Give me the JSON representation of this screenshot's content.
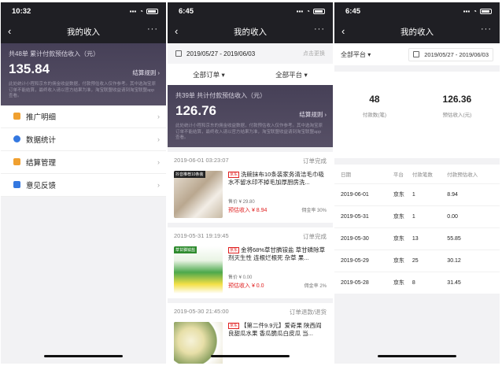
{
  "screens": [
    {
      "time": "10:32",
      "title": "我的收入",
      "more": "···",
      "summary": {
        "count_text": "共48单 累计付款预估收入（元）",
        "amount": "135.84",
        "rule": "结算规则 ›",
        "note": "此处统计小程和京东的佣金收益数据，付款预估收入仅作参考。其中选淘宝原订单不能结算，最终收入请以官方结果为准，淘宝联盟收益请到淘宝联盟app查看。"
      },
      "menu": [
        {
          "label": "推广明细",
          "icon": "list-icon",
          "color": "#f0a030"
        },
        {
          "label": "数据统计",
          "icon": "chart-icon",
          "color": "#3478e0"
        },
        {
          "label": "结算管理",
          "icon": "settlement-icon",
          "color": "#f0a030"
        },
        {
          "label": "意见反馈",
          "icon": "feedback-icon",
          "color": "#3478e0"
        }
      ]
    },
    {
      "time": "6:45",
      "title": "我的收入",
      "more": "···",
      "date_range": "2019/05/27 - 2019/06/03",
      "date_change": "点击更换",
      "filters": [
        "全部订单 ▾",
        "全部平台 ▾"
      ],
      "summary": {
        "count_text": "共39单 共计付款预估收入（元）",
        "amount": "126.76",
        "rule": "结算规则 ›",
        "note": "此处统计小程和京东的佣金收益数据，付款预估收入仅作参考。其中选淘宝原订单不能结算，最终收入请以官方结果为准，淘宝联盟收益请到淘宝联盟app查看。"
      },
      "orders": [
        {
          "time": "2019-06-01 03:23:07",
          "status": "订单完成",
          "platform": "京东",
          "title": "洗碗抹布10条装家务清洁毛巾吸水不留水印不掉毛加厚厨房洗...",
          "thumb_tag": "抖音推荐10条装",
          "price": "售价 ¥ 29.80",
          "estimate": "预估收入 ¥ 8.94",
          "rate": "佣金率 30%"
        },
        {
          "time": "2019-05-31 19:19:45",
          "status": "订单完成",
          "platform": "京东",
          "title": "金将68%草甘膦铵盐 草甘磷除草剂灭生性 连根烂根死 杂草 果...",
          "thumb_tag": "草甘膦铵盐",
          "price": "售价 ¥ 0.00",
          "estimate": "预估收入 ¥ 0.0",
          "rate": "佣金率 2%"
        },
        {
          "time": "2019-05-30 21:45:00",
          "status": "订单退款/退货",
          "platform": "京东",
          "title": "【第二件9.9元】爱奇果 陕西阎良甜瓜水果 香瓜脆瓜白皮瓜 当...",
          "thumb_tag": "",
          "price": "",
          "estimate": "",
          "rate": ""
        }
      ]
    },
    {
      "time": "6:45",
      "title": "我的收入",
      "more": "···",
      "platform_filter": "全部平台 ▾",
      "date_range": "2019/05/27 - 2019/06/03",
      "stats": [
        {
          "value": "48",
          "label": "付款数(笔)"
        },
        {
          "value": "126.36",
          "label": "预估收入(元)"
        }
      ],
      "table_headers": [
        "日期",
        "平台",
        "付款笔数",
        "付款预估收入"
      ],
      "rows": [
        [
          "2019-06-01",
          "京东",
          "1",
          "8.94"
        ],
        [
          "2019-05-31",
          "京东",
          "1",
          "0.00"
        ],
        [
          "2019-05-30",
          "京东",
          "13",
          "55.85"
        ],
        [
          "2019-05-29",
          "京东",
          "25",
          "30.12"
        ],
        [
          "2019-05-28",
          "京东",
          "8",
          "31.45"
        ]
      ]
    }
  ]
}
